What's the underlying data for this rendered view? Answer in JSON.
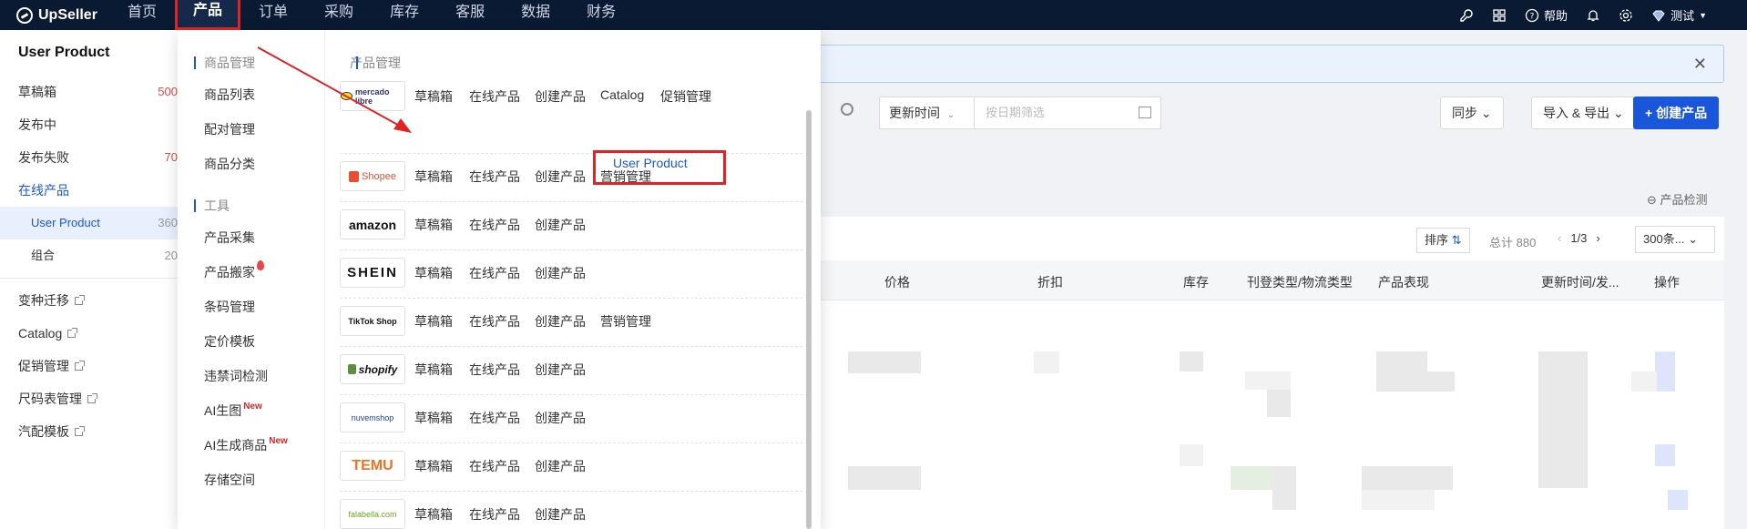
{
  "brand": "UpSeller",
  "nav": [
    "首页",
    "产品",
    "订单",
    "采购",
    "库存",
    "客服",
    "数据",
    "财务"
  ],
  "top_right": {
    "help": "帮助",
    "user": "测试"
  },
  "sidebar": {
    "title": "User Product",
    "items": [
      {
        "label": "草稿箱",
        "count": "500"
      },
      {
        "label": "发布中",
        "count": ""
      },
      {
        "label": "发布失败",
        "count": "70"
      },
      {
        "label": "在线产品",
        "count": ""
      },
      {
        "label": "User Product",
        "count": "360"
      },
      {
        "label": "组合",
        "count": "20"
      }
    ],
    "links": [
      "变种迁移",
      "Catalog",
      "促销管理",
      "尺码表管理",
      "汽配模板"
    ]
  },
  "filters": {
    "time_select": "更新时间",
    "date_placeholder": "按日期筛选",
    "sync": "同步",
    "import_export": "导入 & 导出",
    "create": "+ 创建产品"
  },
  "check_link": "产品检测",
  "toolbar": {
    "sort": "排序",
    "total": "总计 880",
    "page": "1/3",
    "page_size": "300条..."
  },
  "columns": [
    "价格",
    "折扣",
    "库存",
    "刊登类型/物流类型",
    "产品表现",
    "更新时间/发...",
    "操作"
  ],
  "menu": {
    "goods_group": "商品管理",
    "goods_items": [
      "商品列表",
      "配对管理",
      "商品分类"
    ],
    "tools_group": "工具",
    "tools_items": [
      {
        "label": "产品采集",
        "tag": ""
      },
      {
        "label": "产品搬家",
        "tag": "fire"
      },
      {
        "label": "条码管理",
        "tag": ""
      },
      {
        "label": "定价模板",
        "tag": ""
      },
      {
        "label": "违禁词检测",
        "tag": ""
      },
      {
        "label": "AI生图",
        "tag": "New"
      },
      {
        "label": "AI生成商品",
        "tag": "New"
      },
      {
        "label": "存储空间",
        "tag": ""
      }
    ],
    "product_group": "产品管理",
    "marketplaces": [
      {
        "name": "mercado libre",
        "links": [
          "草稿箱",
          "在线产品",
          "创建产品",
          "Catalog",
          "促销管理"
        ],
        "sub": "User Product"
      },
      {
        "name": "Shopee",
        "links": [
          "草稿箱",
          "在线产品",
          "创建产品",
          "营销管理"
        ]
      },
      {
        "name": "amazon",
        "links": [
          "草稿箱",
          "在线产品",
          "创建产品"
        ]
      },
      {
        "name": "SHEIN",
        "links": [
          "草稿箱",
          "在线产品",
          "创建产品"
        ]
      },
      {
        "name": "TikTok Shop",
        "links": [
          "草稿箱",
          "在线产品",
          "创建产品",
          "营销管理"
        ]
      },
      {
        "name": "shopify",
        "links": [
          "草稿箱",
          "在线产品",
          "创建产品"
        ]
      },
      {
        "name": "nuvemshop",
        "links": [
          "草稿箱",
          "在线产品",
          "创建产品"
        ]
      },
      {
        "name": "TEMU",
        "links": [
          "草稿箱",
          "在线产品",
          "创建产品"
        ]
      },
      {
        "name": "falabella.com",
        "links": [
          "草稿箱",
          "在线产品",
          "创建产品"
        ]
      }
    ]
  },
  "colors": {
    "nav_bg": "#0b1a33",
    "accent": "#1a56db",
    "highlight": "#e02424"
  }
}
